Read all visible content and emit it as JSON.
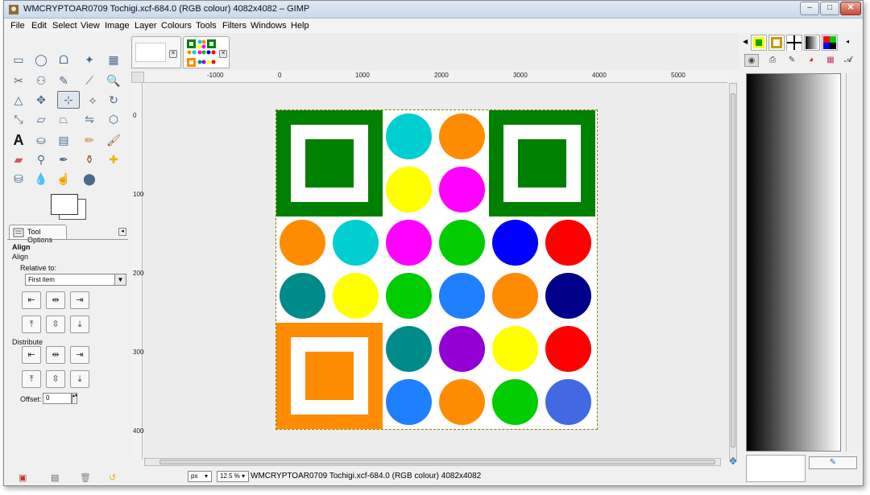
{
  "window": {
    "title": "WMCRYPTOAR0709 Tochigi.xcf-684.0 (RGB colour) 4082x4082 – GIMP",
    "controls": [
      "–",
      "□",
      "✕"
    ]
  },
  "menubar": [
    "File",
    "Edit",
    "Select",
    "View",
    "Image",
    "Layer",
    "Colours",
    "Tools",
    "Filters",
    "Windows",
    "Help"
  ],
  "tool_options": {
    "tab_label": "Tool Options",
    "title": "Align",
    "subtitle": "Align",
    "relative_label": "Relative to:",
    "relative_value": "First item",
    "distribute_label": "Distribute",
    "offset_label": "Offset:",
    "offset_value": "0"
  },
  "ruler": {
    "horizontal": [
      "-1000",
      "0",
      "1000",
      "2000",
      "3000",
      "4000",
      "5000"
    ],
    "vertical": [
      "0",
      "1000",
      "2000",
      "3000",
      "4000"
    ]
  },
  "statusbar": {
    "unit": "px",
    "zoom": "12.5 %",
    "text": "WMCRYPTOAR0709 Tochigi.xcf-684.0 (RGB colour) 4082x4082"
  },
  "image": {
    "dots": [
      {
        "color": "#00ced1"
      },
      {
        "color": "#ff8c00"
      },
      {
        "color": "#ffff00"
      },
      {
        "color": "#ff00ff"
      },
      {
        "color": "#ff8c00"
      },
      {
        "color": "#00ced1"
      },
      {
        "color": "#ff00ff"
      },
      {
        "color": "#00cc00"
      },
      {
        "color": "#0000ff"
      },
      {
        "color": "#ff0000"
      },
      {
        "color": "#008b8b"
      },
      {
        "color": "#ffff00"
      },
      {
        "color": "#00cc00"
      },
      {
        "color": "#1e7fff"
      },
      {
        "color": "#ff8c00"
      },
      {
        "color": "#00008b"
      },
      {
        "color": "#008b8b"
      },
      {
        "color": "#9400d3"
      },
      {
        "color": "#ffff00"
      },
      {
        "color": "#ff0000"
      },
      {
        "color": "#1e7fff"
      },
      {
        "color": "#ff8c00"
      },
      {
        "color": "#00cc00"
      },
      {
        "color": "#4169e1"
      }
    ],
    "squares": [
      {
        "color": "#008000"
      },
      {
        "color": "#008000"
      },
      {
        "color": "#ff8c00"
      }
    ]
  }
}
